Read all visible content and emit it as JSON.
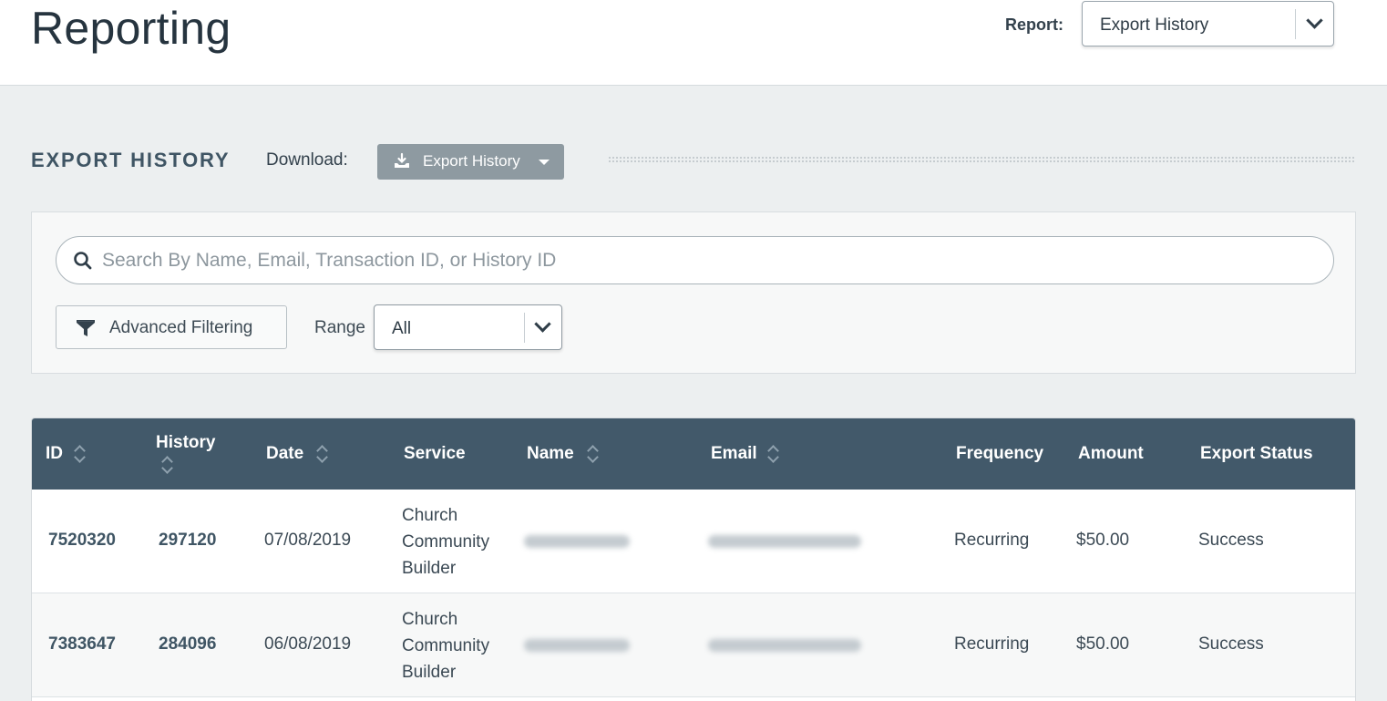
{
  "header": {
    "title": "Reporting",
    "report_label": "Report:",
    "report_value": "Export History"
  },
  "section": {
    "title": "EXPORT HISTORY",
    "download_label": "Download:",
    "download_button": "Export History"
  },
  "filters": {
    "search_placeholder": "Search By Name, Email, Transaction ID, or History ID",
    "search_value": "",
    "advanced_label": "Advanced Filtering",
    "range_label": "Range",
    "range_value": "All"
  },
  "table": {
    "columns": [
      "ID",
      "History",
      "Date",
      "Service",
      "Name",
      "Email",
      "Frequency",
      "Amount",
      "Export Status"
    ],
    "rows": [
      {
        "id": "7520320",
        "history": "297120",
        "date": "07/08/2019",
        "service": [
          "Church",
          "Community",
          "Builder"
        ],
        "frequency": "Recurring",
        "amount": "$50.00",
        "status": "Success"
      },
      {
        "id": "7383647",
        "history": "284096",
        "date": "06/08/2019",
        "service": [
          "Church",
          "Community",
          "Builder"
        ],
        "frequency": "Recurring",
        "amount": "$50.00",
        "status": "Success"
      }
    ]
  },
  "icons": {
    "report_select": "chevron-down-icon",
    "download": "download-icon",
    "download_menu": "caret-down-icon",
    "search": "search-icon",
    "filter": "filter-icon",
    "range_select": "chevron-down-icon",
    "sort": "sort-icon"
  },
  "colors": {
    "table_header": "#42596a",
    "download_button": "#8e9aa1",
    "page_background": "#eceff0"
  }
}
